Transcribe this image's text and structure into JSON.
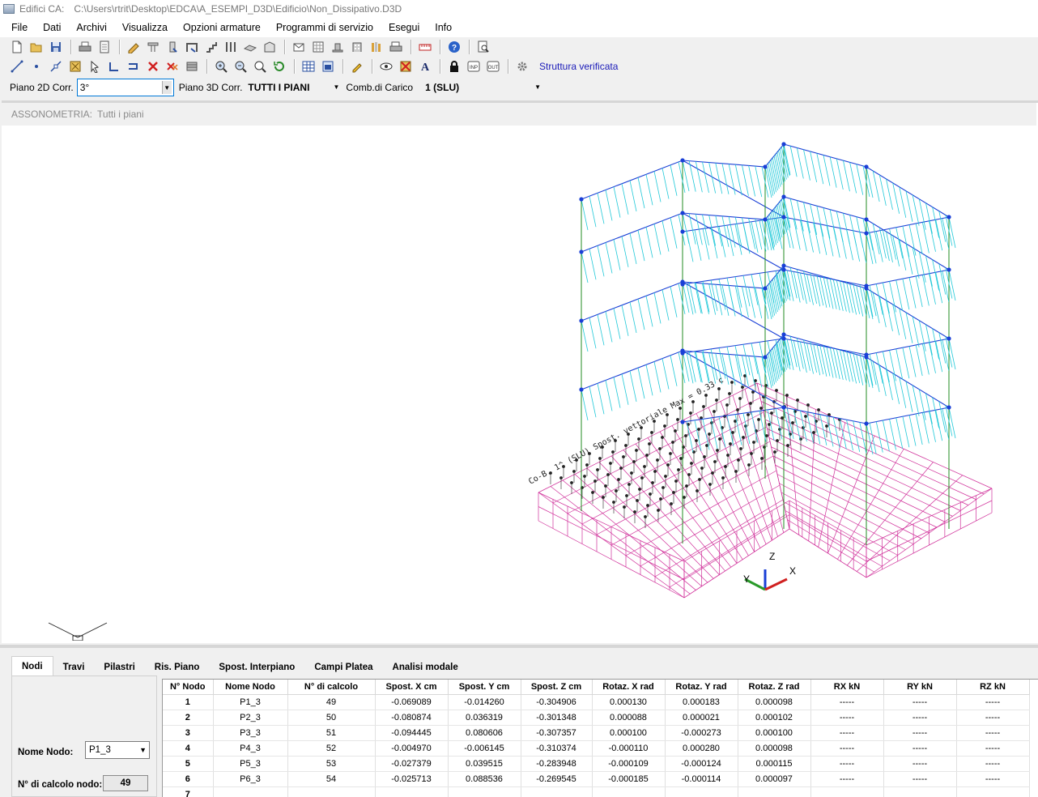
{
  "window": {
    "app_title": "Edifici CA:",
    "file_path": "C:\\Users\\rtrit\\Desktop\\EDCA\\A_ESEMPI_D3D\\Edificio\\Non_Dissipativo.D3D"
  },
  "menu": [
    "File",
    "Dati",
    "Archivi",
    "Visualizza",
    "Opzioni armature",
    "Programmi di servizio",
    "Esegui",
    "Info"
  ],
  "toolbar2": {
    "status": "Struttura verificata"
  },
  "selectors": {
    "piano2d_label": "Piano 2D Corr.",
    "piano2d_value": "3°",
    "piano3d_label": "Piano 3D Corr.",
    "piano3d_value": "TUTTI I PIANI",
    "comb_label": "Comb.di Carico",
    "comb_value": "1  (SLU)"
  },
  "view": {
    "mode_label": "ASSONOMETRIA:",
    "mode_value": "Tutti i piani",
    "annotation": "Co-B. 1^ (SLU)  Spost. vettoriale Max = 0.33 c",
    "axes": {
      "z": "Z",
      "y": "Y",
      "x": "X"
    }
  },
  "tabs": [
    "Nodi",
    "Travi",
    "Pilastri",
    "Ris. Piano",
    "Spost. Interpiano",
    "Campi Platea",
    "Analisi modale"
  ],
  "active_tab": "Nodi",
  "node_panel": {
    "name_label": "Nome Nodo:",
    "name_value": "P1_3",
    "calc_label": "N° di calcolo nodo:",
    "calc_value": "49"
  },
  "table": {
    "columns": [
      "N° Nodo",
      "Nome Nodo",
      "N° di calcolo",
      "Spost. X cm",
      "Spost. Y cm",
      "Spost. Z cm",
      "Rotaz. X rad",
      "Rotaz. Y rad",
      "Rotaz. Z rad",
      "RX  kN",
      "RY  kN",
      "RZ  kN"
    ],
    "rows": [
      [
        "1",
        "P1_3",
        "49",
        "-0.069089",
        "-0.014260",
        "-0.304906",
        "0.000130",
        "0.000183",
        "0.000098",
        "-----",
        "-----",
        "-----"
      ],
      [
        "2",
        "P2_3",
        "50",
        "-0.080874",
        "0.036319",
        "-0.301348",
        "0.000088",
        "0.000021",
        "0.000102",
        "-----",
        "-----",
        "-----"
      ],
      [
        "3",
        "P3_3",
        "51",
        "-0.094445",
        "0.080606",
        "-0.307357",
        "0.000100",
        "-0.000273",
        "0.000100",
        "-----",
        "-----",
        "-----"
      ],
      [
        "4",
        "P4_3",
        "52",
        "-0.004970",
        "-0.006145",
        "-0.310374",
        "-0.000110",
        "0.000280",
        "0.000098",
        "-----",
        "-----",
        "-----"
      ],
      [
        "5",
        "P5_3",
        "53",
        "-0.027379",
        "0.039515",
        "-0.283948",
        "-0.000109",
        "-0.000124",
        "0.000115",
        "-----",
        "-----",
        "-----"
      ],
      [
        "6",
        "P6_3",
        "54",
        "-0.025713",
        "0.088536",
        "-0.269545",
        "-0.000185",
        "-0.000114",
        "0.000097",
        "-----",
        "-----",
        "-----"
      ],
      [
        "7",
        "",
        "",
        "",
        "",
        "",
        "",
        "",
        "",
        "",
        "",
        ""
      ]
    ]
  }
}
